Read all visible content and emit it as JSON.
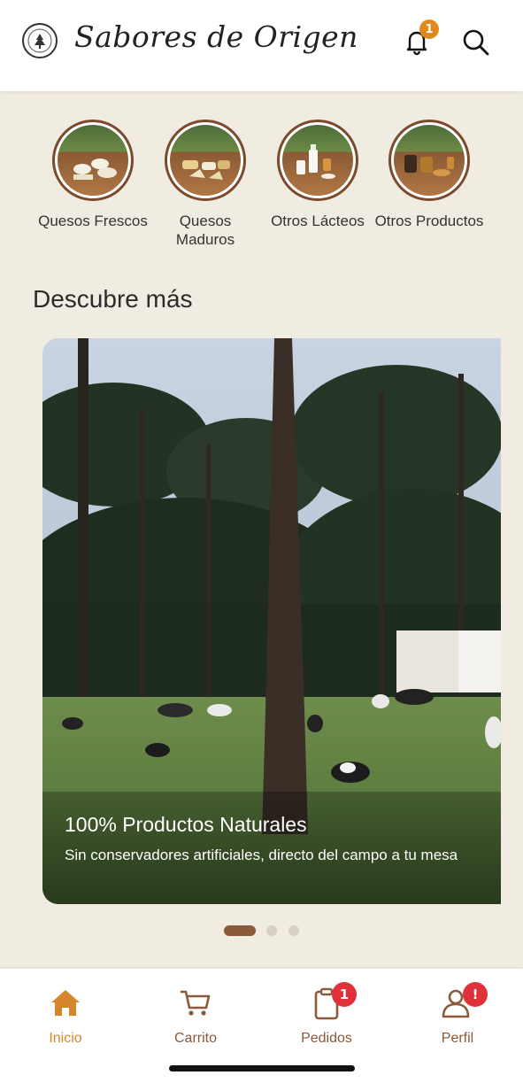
{
  "header": {
    "brand": "Sabores de Origen",
    "notification_count": "1"
  },
  "categories": [
    {
      "label": "Quesos Frescos"
    },
    {
      "label": "Quesos Maduros"
    },
    {
      "label": "Otros Lácteos"
    },
    {
      "label": "Otros Productos"
    }
  ],
  "section_title": "Descubre más",
  "carousel": {
    "title": "100% Productos Naturales",
    "subtitle": "Sin conservadores artificiales, directo del campo a tu mesa",
    "active_index": 0,
    "total": 3
  },
  "nav": {
    "items": [
      {
        "label": "Inicio"
      },
      {
        "label": "Carrito"
      },
      {
        "label": "Pedidos",
        "badge": "1"
      },
      {
        "label": "Perfil",
        "badge": "!"
      }
    ]
  },
  "colors": {
    "background": "#f1ece1",
    "accent": "#d6862a",
    "brown": "#8a5a3a",
    "badge_red": "#e0303a",
    "badge_orange": "#e08a1e"
  }
}
